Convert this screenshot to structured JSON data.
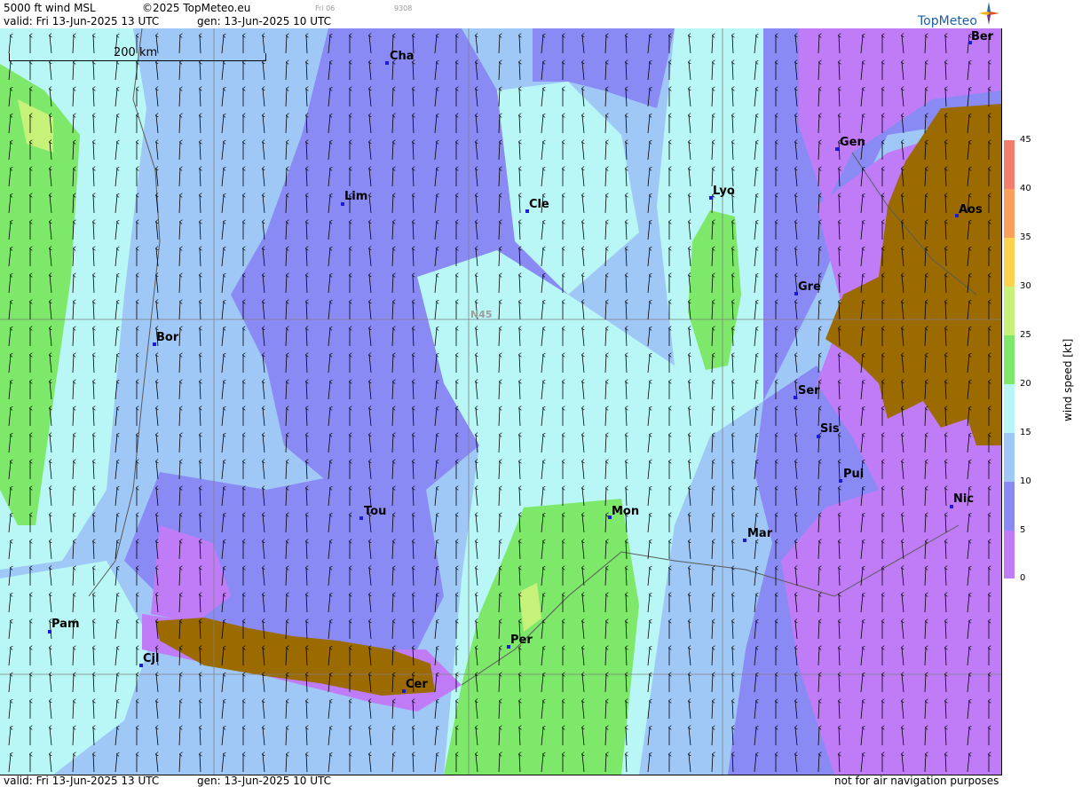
{
  "header": {
    "product": "5000 ft wind MSL",
    "copyright": "©2025 TopMeteo.eu",
    "run_small": "Fri 06",
    "code_small": "9308",
    "valid": "valid:  Fri  13-Jun-2025  13 UTC",
    "gen": "gen: 13-Jun-2025 10 UTC",
    "logo": "TopMeteo"
  },
  "map": {
    "scale_label": "200 km",
    "latitude_label": "N45",
    "cities": [
      {
        "name": "Cha"
      },
      {
        "name": "Ber"
      },
      {
        "name": "Lim"
      },
      {
        "name": "Cle"
      },
      {
        "name": "Lyo"
      },
      {
        "name": "Gen"
      },
      {
        "name": "Aos"
      },
      {
        "name": "Gre"
      },
      {
        "name": "Bor"
      },
      {
        "name": "Ser"
      },
      {
        "name": "Sis"
      },
      {
        "name": "Pui"
      },
      {
        "name": "Nic"
      },
      {
        "name": "Tou"
      },
      {
        "name": "Mon"
      },
      {
        "name": "Mar"
      },
      {
        "name": "Pam"
      },
      {
        "name": "Cjl"
      },
      {
        "name": "Per"
      },
      {
        "name": "Cer"
      }
    ]
  },
  "legend": {
    "title": "wind speed [kt]",
    "ticks": [
      "45",
      "40",
      "35",
      "30",
      "25",
      "20",
      "15",
      "10",
      "5",
      "0"
    ],
    "colors": [
      "#f47e6e",
      "#f9a15c",
      "#fdd24f",
      "#f6f76a",
      "#c7f27a",
      "#7ee86a",
      "#b8f7f5",
      "#9fc8f7",
      "#8a8af4",
      "#c07cf6"
    ]
  },
  "footer": {
    "valid": "valid:  Fri  13-Jun-2025  13 UTC",
    "gen": "gen: 13-Jun-2025 10 UTC",
    "disclaimer": "not for air navigation purposes"
  }
}
